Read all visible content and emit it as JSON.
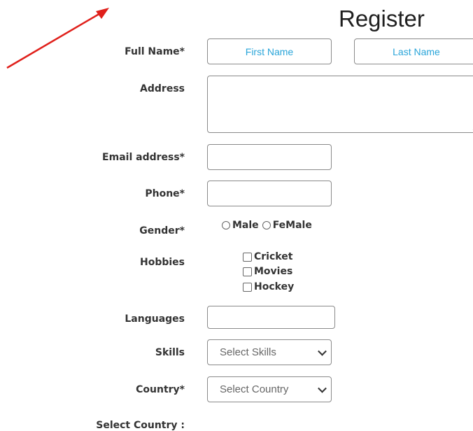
{
  "form": {
    "title": "Register",
    "full_name_label": "Full Name*",
    "first_name_placeholder": "First Name",
    "last_name_placeholder": "Last Name",
    "address_label": "Address",
    "email_label": "Email address*",
    "phone_label": "Phone*",
    "gender_label": "Gender*",
    "gender_options": [
      "Male",
      "FeMale"
    ],
    "hobbies_label": "Hobbies",
    "hobbies": [
      "Cricket",
      "Movies",
      "Hockey"
    ],
    "languages_label": "Languages",
    "skills_label": "Skills",
    "skills_select_value": "Select Skills",
    "country_label": "Country*",
    "country_select_value": "Select Country",
    "select_country_label": "Select Country :"
  },
  "colors": {
    "placeholder": "#2aa5d9",
    "annotation_arrow": "#e0201b"
  }
}
